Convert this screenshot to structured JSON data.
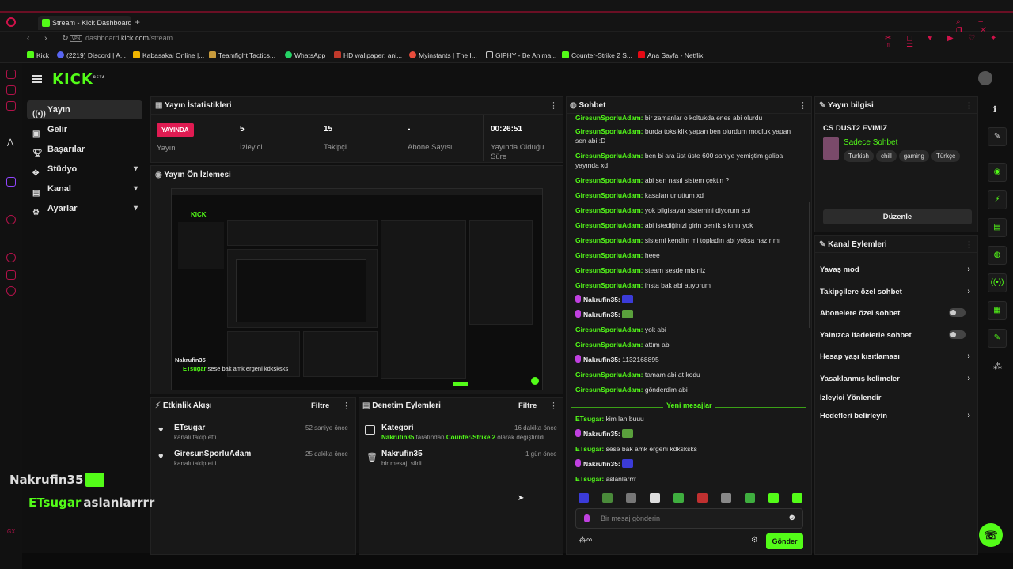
{
  "browser": {
    "tab_title": "Stream - Kick Dashboard",
    "url_host": "dashboard.",
    "url_domain": "kick.com",
    "url_path": "/stream",
    "bookmarks": [
      "Kick",
      "(2219) Discord | A...",
      "Kabasakal Online |...",
      "Teamfight Tactics...",
      "WhatsApp",
      "HD wallpaper: ani...",
      "Myinstants | The I...",
      "GIPHY - Be Anima...",
      "Counter-Strike 2 S...",
      "Ana Sayfa - Netflix"
    ]
  },
  "header": {
    "logo": "KICK",
    "logo_badge": "BETA"
  },
  "sidebar": {
    "items": [
      {
        "label": "Yayın",
        "icon": "broadcast-icon"
      },
      {
        "label": "Gelir",
        "icon": "wallet-icon"
      },
      {
        "label": "Başarılar",
        "icon": "trophy-icon"
      },
      {
        "label": "Stüdyo",
        "icon": "studio-icon"
      },
      {
        "label": "Kanal",
        "icon": "channel-icon"
      },
      {
        "label": "Ayarlar",
        "icon": "gear-icon"
      }
    ]
  },
  "stats": {
    "title": "Yayın İstatistikleri",
    "live_badge": "YAYINDA",
    "live_label": "Yayın",
    "viewers_value": "5",
    "viewers_label": "İzleyici",
    "followers_value": "15",
    "followers_label": "Takipçi",
    "subs_value": "-",
    "subs_label": "Abone Sayısı",
    "uptime_value": "00:26:51",
    "uptime_label_1": "Yayında Olduğu",
    "uptime_label_2": "Süre"
  },
  "preview": {
    "title": "Yayın Ön İzlemesi",
    "overlay_user1": "Nakrufin35",
    "overlay_user2": "ETsugar",
    "overlay_msg": "sese bak amk ergeni kdksksks"
  },
  "activity": {
    "title": "Etkinlik Akışı",
    "filter": "Filtre",
    "items": [
      {
        "name": "ETsugar",
        "sub": "kanalı takip etti",
        "time": "52 saniye önce"
      },
      {
        "name": "GiresunSporluAdam",
        "sub": "kanalı takip etti",
        "time": "25 dakika önce"
      }
    ]
  },
  "moderation": {
    "title": "Denetim Eylemleri",
    "filter": "Filtre",
    "items": [
      {
        "name": "Kategori",
        "time": "16 dakika önce",
        "sub_user": "Nakrufin35",
        "sub_mid": " tarafından ",
        "sub_game": "Counter-Strike 2",
        "sub_end": " olarak değiştirildi"
      },
      {
        "name": "Nakrufin35",
        "sub": "bir mesajı sildi",
        "time": "1 gün önce"
      }
    ]
  },
  "chat": {
    "title": "Sohbet",
    "messages": [
      {
        "user": "GiresunSporluAdam",
        "text": "bir zamanlar o koltukda enes abi olurdu"
      },
      {
        "user": "GiresunSporluAdam",
        "text": "burda toksiklik yapan ben olurdum modluk yapan"
      },
      {
        "user": "",
        "text": "sen abi :D"
      },
      {
        "user": "GiresunSporluAdam",
        "text": "ben bi ara üst üste 600 saniye yemiştim galiba"
      },
      {
        "user": "",
        "text": "yayında xd"
      },
      {
        "user": "GiresunSporluAdam",
        "text": "abi sen nasıl sistem çektin ?"
      },
      {
        "user": "GiresunSporluAdam",
        "text": "kasaları unuttum xd"
      },
      {
        "user": "GiresunSporluAdam",
        "text": "yok bilgisayar sistemini diyorum abi"
      },
      {
        "user": "GiresunSporluAdam",
        "text": "abi istediğinizi girin benlik sıkıntı yok"
      },
      {
        "user": "GiresunSporluAdam",
        "text": "sistemi kendim mi topladın abi yoksa hazır mı"
      },
      {
        "user": "GiresunSporluAdam",
        "text": "heee"
      },
      {
        "user": "GiresunSporluAdam",
        "text": "steam sesde misiniz"
      },
      {
        "user": "GiresunSporluAdam",
        "text": "insta bak abi atıyorum"
      },
      {
        "user": "Nakrufin35",
        "text": "",
        "emote": "#3b3bd8",
        "mic": true
      },
      {
        "user": "Nakrufin35",
        "text": "",
        "emote": "#5aa03c",
        "mic": true
      },
      {
        "user": "GiresunSporluAdam",
        "text": "yok abi"
      },
      {
        "user": "GiresunSporluAdam",
        "text": "attım abi"
      },
      {
        "user": "Nakrufin35",
        "text": "1132168895",
        "mic": true
      },
      {
        "user": "GiresunSporluAdam",
        "text": "tamam abi at kodu"
      },
      {
        "user": "GiresunSporluAdam",
        "text": "gönderdim abi"
      }
    ],
    "new_messages": "Yeni mesajlar",
    "new": [
      {
        "user": "ETsugar",
        "text": "kim lan buuu"
      },
      {
        "user": "Nakrufin35",
        "text": "",
        "emote": "#5aa03c",
        "mic": true
      },
      {
        "user": "ETsugar",
        "text": "sese bak amk ergeni kdksksks"
      },
      {
        "user": "Nakrufin35",
        "text": "",
        "emote": "#3b3bd8",
        "mic": true
      },
      {
        "user": "ETsugar",
        "text": "aslanlarrrr"
      }
    ],
    "emotes": [
      "#3b3bd8",
      "#4a8a3a",
      "#777",
      "#ddd",
      "#3fae3f",
      "#c03030",
      "#888",
      "#3fae3f",
      "#53fc18",
      "#53fc18"
    ],
    "input_placeholder": "Bir mesaj gönderin",
    "send": "Gönder"
  },
  "stream_info": {
    "title": "Yayın bilgisi",
    "stream_title": "CS DUST2 EVIMIZ",
    "category": "Sadece Sohbet",
    "tags": [
      "Turkish",
      "chill",
      "gaming",
      "Türkçe"
    ],
    "edit": "Düzenle"
  },
  "channel_actions": {
    "title": "Kanal Eylemleri",
    "items": [
      {
        "label": "Yavaş mod",
        "control": "chevron"
      },
      {
        "label": "Takipçilere özel sohbet",
        "control": "chevron"
      },
      {
        "label": "Abonelere özel sohbet",
        "control": "toggle"
      },
      {
        "label": "Yalnızca ifadelerle sohbet",
        "control": "toggle"
      },
      {
        "label": "Hesap yaşı kısıtlaması",
        "control": "chevron"
      },
      {
        "label": "Yasaklanmış kelimeler",
        "control": "chevron"
      },
      {
        "label": "İzleyici Yönlendir",
        "control": "none"
      },
      {
        "label": "Hedefleri belirleyin",
        "control": "chevron"
      }
    ]
  },
  "stream_overlay": {
    "user1": "Nakrufin35",
    "user2": "ETsugar",
    "msg": "aslanlarrrr"
  },
  "colors": {
    "accent": "#53fc18",
    "live": "#e01b52",
    "browser_accent": "#b3124a"
  }
}
